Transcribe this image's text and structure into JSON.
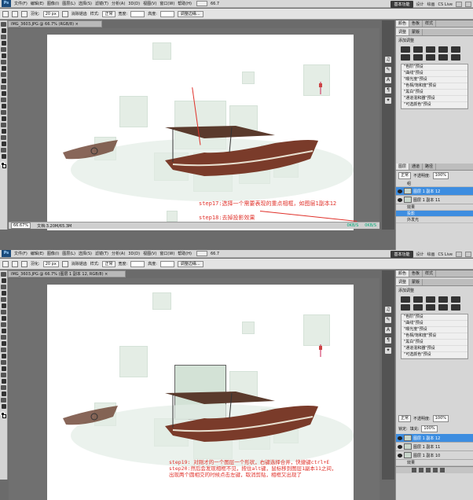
{
  "app": {
    "logo": "Ps",
    "menus": [
      "文件(F)",
      "编辑(E)",
      "图像(I)",
      "图层(L)",
      "选择(S)",
      "滤镜(T)",
      "分析(A)",
      "3D(D)",
      "视图(V)",
      "窗口(W)",
      "帮助(H)"
    ],
    "zoom_menu": "66.7",
    "workspace": "基本功能",
    "workspace_links": [
      "设计",
      "绘画"
    ],
    "cs_live": "CS Live"
  },
  "options": {
    "feather_label": "羽化:",
    "feather_value": "20 px",
    "antialias": "消除锯齿",
    "style_label": "样式:",
    "style_value": "正常",
    "width_label": "宽度:",
    "height_label": "高度:",
    "refine_edge": "调整边缘..."
  },
  "top": {
    "doc_tab": "IMG_3603.JPG @ 66.7% (RGB/8) ×",
    "status_zoom": "66.67%",
    "status_doc": "文档:3.20M/65.3M",
    "annotation_17": "step17:选择一个需要表现的重点相框，如图层1副本12",
    "annotation_18": "step18:去掉投影效果",
    "net_speed": [
      "0KB/S",
      "0KB/S"
    ]
  },
  "bottom": {
    "doc_tab": "IMG_3603.JPG @ 66.7% (图层 1 副本 12, RGB/8) ×",
    "annotation_19": "step19: 对刚才的一个图层一个形状，右键选择合并，快捷键ctrl+E",
    "annotation_20a": "step20:然后会发现相框不见，按住alt键，鼠标移到图层1副本11之间，",
    "annotation_20b": "出现两个圆相交的时候点击左键，取消剪贴，相框又出现了"
  },
  "panels": {
    "tabs_top": [
      "颜色",
      "色板",
      "样式"
    ],
    "tabs_adj": [
      "调整",
      "蒙版"
    ],
    "adj_title": "添加调整",
    "presets": [
      "\"色阶\"预设",
      "\"曲线\"预设",
      "\"曝光度\"预设",
      "\"色相/饱和度\"预设",
      "\"黑白\"预设",
      "\"通道混和器\"预设",
      "\"可选颜色\"预设"
    ],
    "layer_tabs": [
      "图层",
      "通道",
      "路径"
    ],
    "blend_mode": "正常",
    "opacity_label": "不透明度:",
    "opacity_value": "100%",
    "lock_label": "锁定:",
    "fill_label": "填充:",
    "fill_value": "100%",
    "layers_top": [
      {
        "name": "图层 1 副本 12",
        "selected": true
      },
      {
        "name": "图层 1 副本 11",
        "selected": false
      }
    ],
    "effects_label": "效果",
    "drop_shadow": "投影",
    "outer_glow": "外发光",
    "group_label": "组",
    "layers_bottom": [
      {
        "name": "图层 1 副本 12",
        "selected": true
      },
      {
        "name": "图层 1 副本 11",
        "selected": false
      },
      {
        "name": "图层 1 副本 10",
        "selected": false
      }
    ]
  },
  "colors": {
    "annotation": "#e0312a",
    "selection": "#3d8de0"
  }
}
